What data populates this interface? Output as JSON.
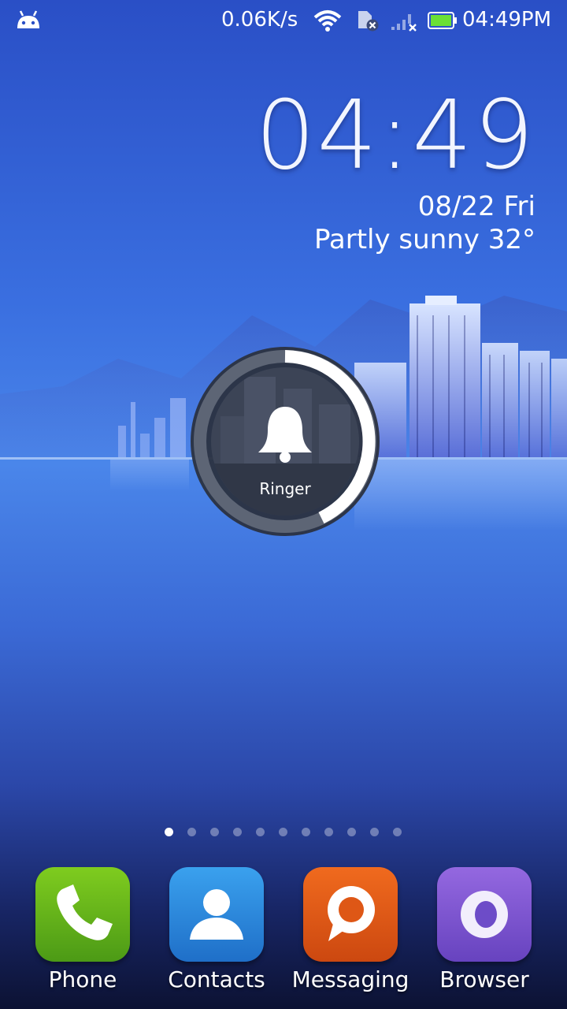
{
  "status_bar": {
    "network_speed": "0.06K/s",
    "time": "04:49PM",
    "icons": [
      "android-icon",
      "wifi-icon",
      "sim-disabled-icon",
      "signal-none-icon",
      "battery-icon"
    ]
  },
  "clock_widget": {
    "time": "04:49",
    "date": "08/22 Fri",
    "weather": "Partly sunny  32°"
  },
  "ringer_dial": {
    "label": "Ringer",
    "icon": "bell-icon"
  },
  "page_indicator": {
    "count": 11,
    "active_index": 0
  },
  "dock": {
    "apps": [
      {
        "label": "Phone",
        "icon": "phone-icon",
        "color": "#5aad1e"
      },
      {
        "label": "Contacts",
        "icon": "contacts-icon",
        "color": "#2a86dc"
      },
      {
        "label": "Messaging",
        "icon": "messaging-icon",
        "color": "#e05a18"
      },
      {
        "label": "Browser",
        "icon": "browser-icon",
        "color": "#7d55d0"
      }
    ]
  }
}
